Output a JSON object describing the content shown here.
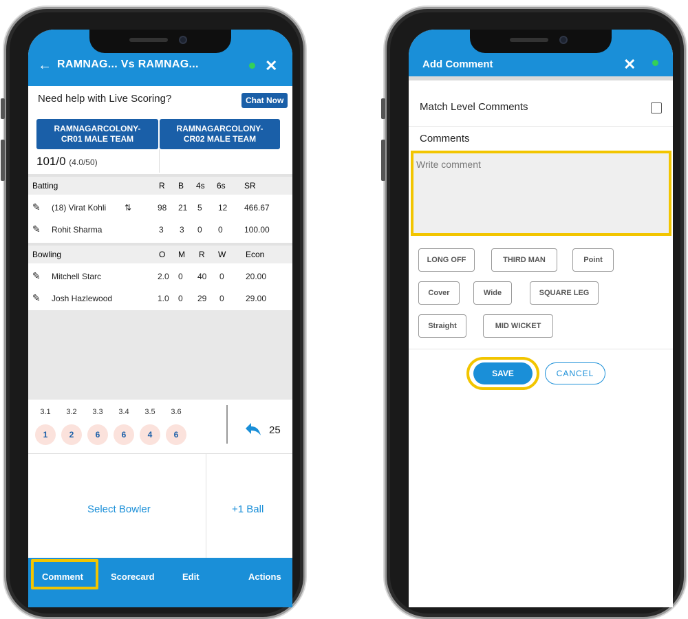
{
  "left": {
    "header": {
      "back_icon": "arrow-left",
      "title": "RAMNAG... Vs  RAMNAG...",
      "status_color": "#34d058",
      "close_icon": "close"
    },
    "help": {
      "text": "Need help with Live Scoring?",
      "chat_label": "Chat Now"
    },
    "teams": [
      {
        "line1": "RAMNAGARCOLONY-",
        "line2": "CR01 MALE TEAM"
      },
      {
        "line1": "RAMNAGARCOLONY-",
        "line2": "CR02 MALE TEAM"
      }
    ],
    "score": {
      "runs": "101/0",
      "overs": "(4.0/50)"
    },
    "batting": {
      "headers": [
        "Batting",
        "R",
        "B",
        "4s",
        "6s",
        "SR"
      ],
      "rows": [
        {
          "name": "(18) Virat Kohli",
          "swap": "⇅",
          "r": "98",
          "b": "21",
          "f4": "5",
          "f6": "12",
          "sr": "466.67"
        },
        {
          "name": "Rohit Sharma",
          "swap": "",
          "r": "3",
          "b": "3",
          "f4": "0",
          "f6": "0",
          "sr": "100.00"
        }
      ]
    },
    "bowling": {
      "headers": [
        "Bowling",
        "O",
        "M",
        "R",
        "W",
        "Econ"
      ],
      "rows": [
        {
          "name": "Mitchell Starc",
          "o": "2.0",
          "m": "0",
          "r": "40",
          "w": "0",
          "econ": "20.00"
        },
        {
          "name": "Josh Hazlewood",
          "o": "1.0",
          "m": "0",
          "r": "29",
          "w": "0",
          "econ": "29.00"
        }
      ]
    },
    "over": {
      "balls": [
        {
          "label": "3.1",
          "value": "1"
        },
        {
          "label": "3.2",
          "value": "2"
        },
        {
          "label": "3.3",
          "value": "6"
        },
        {
          "label": "3.4",
          "value": "6"
        },
        {
          "label": "3.5",
          "value": "4"
        },
        {
          "label": "3.6",
          "value": "6"
        }
      ],
      "undo_icon": "undo-arrow",
      "undo_count": "25"
    },
    "actions": {
      "select_bowler": "Select Bowler",
      "plus_ball": "+1 Ball"
    },
    "nav": [
      "Comment",
      "Scorecard",
      "Edit",
      "Actions"
    ]
  },
  "right": {
    "header": {
      "title": "Add Comment",
      "close_icon": "close",
      "status_color": "#34d058"
    },
    "match_level_label": "Match Level Comments",
    "comments_label": "Comments",
    "comment_placeholder": "Write comment",
    "chips": [
      "LONG OFF",
      "THIRD MAN",
      "Point",
      "Cover",
      "Wide",
      "SQUARE LEG",
      "Straight",
      "MID WICKET"
    ],
    "save_label": "SAVE",
    "cancel_label": "CANCEL"
  },
  "colors": {
    "primary": "#1a8fd8",
    "team_button": "#1a5fa8",
    "highlight": "#f2c500",
    "ball_bg": "#fbe2dc"
  }
}
